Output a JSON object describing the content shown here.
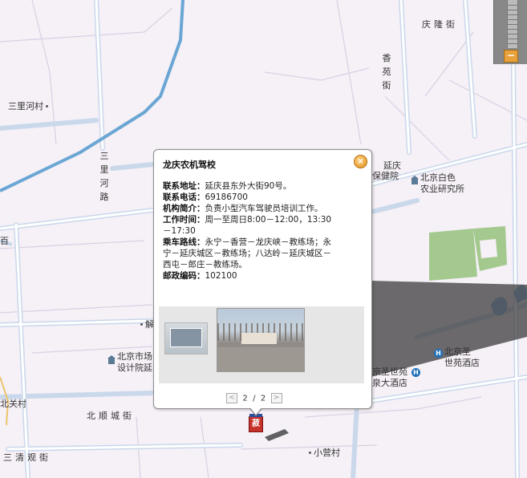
{
  "map": {
    "roads": {
      "qinglong_jie": "庆隆街",
      "xiangyuan_jie": "香苑街",
      "sanlihe_lu": "三里河路",
      "beishun_chengjie": "北顺城街",
      "sanqing_guanjie": "三清观街"
    },
    "places": {
      "sanlihe_cun": "三里河村",
      "yanqing_baojian_yuan_1": "延庆",
      "yanqing_baojian_yuan_2": "保健院",
      "baise_1": "北京白色",
      "baise_2": "农业研究所",
      "shichang_1": "北京市场",
      "shichang_2": "设计院延",
      "shengshiyuan_1": "北京圣",
      "shengshiyuan_2": "世苑酒店",
      "shengshiyuan_left_1": "京圣世苑",
      "shengshiyuan_left_2": "泉大酒店",
      "beiguan_cun": "北关村",
      "xiaoying_cun": "小营村",
      "jie_partial": "解",
      "edge_left": "百"
    },
    "hotel_icon": "H",
    "marker_label": "菽"
  },
  "zoom": {
    "minus_label": "−"
  },
  "popup": {
    "title": "龙庆农机驾校",
    "close_label": "×",
    "details": [
      {
        "key": "联系地址：",
        "value": "延庆县东外大街90号。"
      },
      {
        "key": "联系电话：",
        "value": "69186700"
      },
      {
        "key": "机构简介：",
        "value": "负责小型汽车驾驶员培训工作。"
      },
      {
        "key": "工作时间：",
        "value": "周一至周日8:00－12:00，13:30－17:30"
      },
      {
        "key": "乘车路线：",
        "value": "永宁－香营－龙庆峡－教练场；永宁－延庆城区－教练场；八达岭－延庆城区－西屯－郎庄－教练场。"
      },
      {
        "key": "邮政编码：",
        "value": "102100"
      }
    ],
    "pager": {
      "prev": "<",
      "current": "2",
      "sep": "/",
      "total": "2",
      "next": ">"
    }
  },
  "colors": {
    "map_bg": "#f6f0f7",
    "road": "#c9d8ea",
    "river": "#6aa6d4",
    "park": "#a4c98f",
    "water": "#8fb8e6"
  }
}
